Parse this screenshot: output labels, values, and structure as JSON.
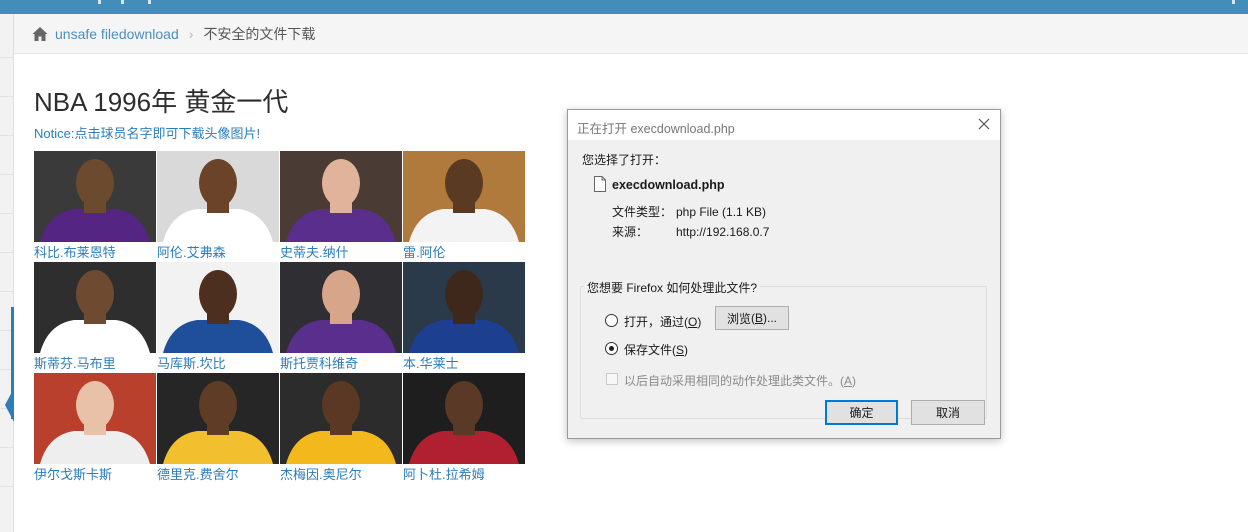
{
  "colors": {
    "topbar": "#438eb9",
    "link": "#2b7dbc",
    "dialog_bg": "#f0f0f0",
    "primary_border": "#0078d7"
  },
  "breadcrumb": {
    "home_icon": "home-icon",
    "link_label": "unsafe filedownload",
    "current_label": "不安全的文件下载"
  },
  "page": {
    "title": "NBA 1996年 黄金一代",
    "notice": "Notice:点击球员名字即可下载头像图片!"
  },
  "players": [
    {
      "name": "科比.布莱恩特",
      "jersey": "#552583",
      "bg": "#3a3a3a",
      "skin": "#6b4a2e"
    },
    {
      "name": "阿伦.艾弗森",
      "jersey": "#ffffff",
      "bg": "#d9d9d9",
      "skin": "#6a4329"
    },
    {
      "name": "史蒂夫.纳什",
      "jersey": "#5a2e8c",
      "bg": "#4a3b34",
      "skin": "#e0b39a"
    },
    {
      "name": "雷.阿伦",
      "jersey": "#f3f3f3",
      "bg": "#b07a3c",
      "skin": "#5b3a24"
    },
    {
      "name": "斯蒂芬.马布里",
      "jersey": "#ffffff",
      "bg": "#2e2e2e",
      "skin": "#6e4a30"
    },
    {
      "name": "马库斯.坎比",
      "jersey": "#1f4f9a",
      "bg": "#f2f2f2",
      "skin": "#4d2f1f"
    },
    {
      "name": "斯托贾科维奇",
      "jersey": "#5a2e8c",
      "bg": "#2f2f33",
      "skin": "#d6a58a"
    },
    {
      "name": "本.华莱士",
      "jersey": "#1d3f8f",
      "bg": "#2b3a4a",
      "skin": "#3e281b"
    },
    {
      "name": "伊尔戈斯卡斯",
      "jersey": "#eeeeee",
      "bg": "#b8402c",
      "skin": "#e8c1a8"
    },
    {
      "name": "德里克.费舍尔",
      "jersey": "#f2c02e",
      "bg": "#262626",
      "skin": "#5e3c26"
    },
    {
      "name": "杰梅因.奥尼尔",
      "jersey": "#f2b81c",
      "bg": "#2c2c2c",
      "skin": "#5a3823"
    },
    {
      "name": "阿卜杜.拉希姆",
      "jersey": "#b12030",
      "bg": "#1e1e1e",
      "skin": "#5a3a26"
    }
  ],
  "dialog": {
    "title": "正在打开 execdownload.php",
    "intro": "您选择了打开：",
    "file_name": "execdownload.php",
    "type_key": "文件类型：",
    "type_value": "php File (1.1 KB)",
    "source_key": "来源：",
    "source_value": "http://192.168.0.7",
    "question": "您想要 Firefox 如何处理此文件?",
    "open_with_label": "打开，通过",
    "open_with_key": "O",
    "browse_label": "浏览",
    "browse_key": "B",
    "save_label": "保存文件",
    "save_key": "S",
    "save_selected": true,
    "auto_label": "以后自动采用相同的动作处理此类文件。",
    "auto_key": "A",
    "ok_label": "确定",
    "cancel_label": "取消"
  }
}
